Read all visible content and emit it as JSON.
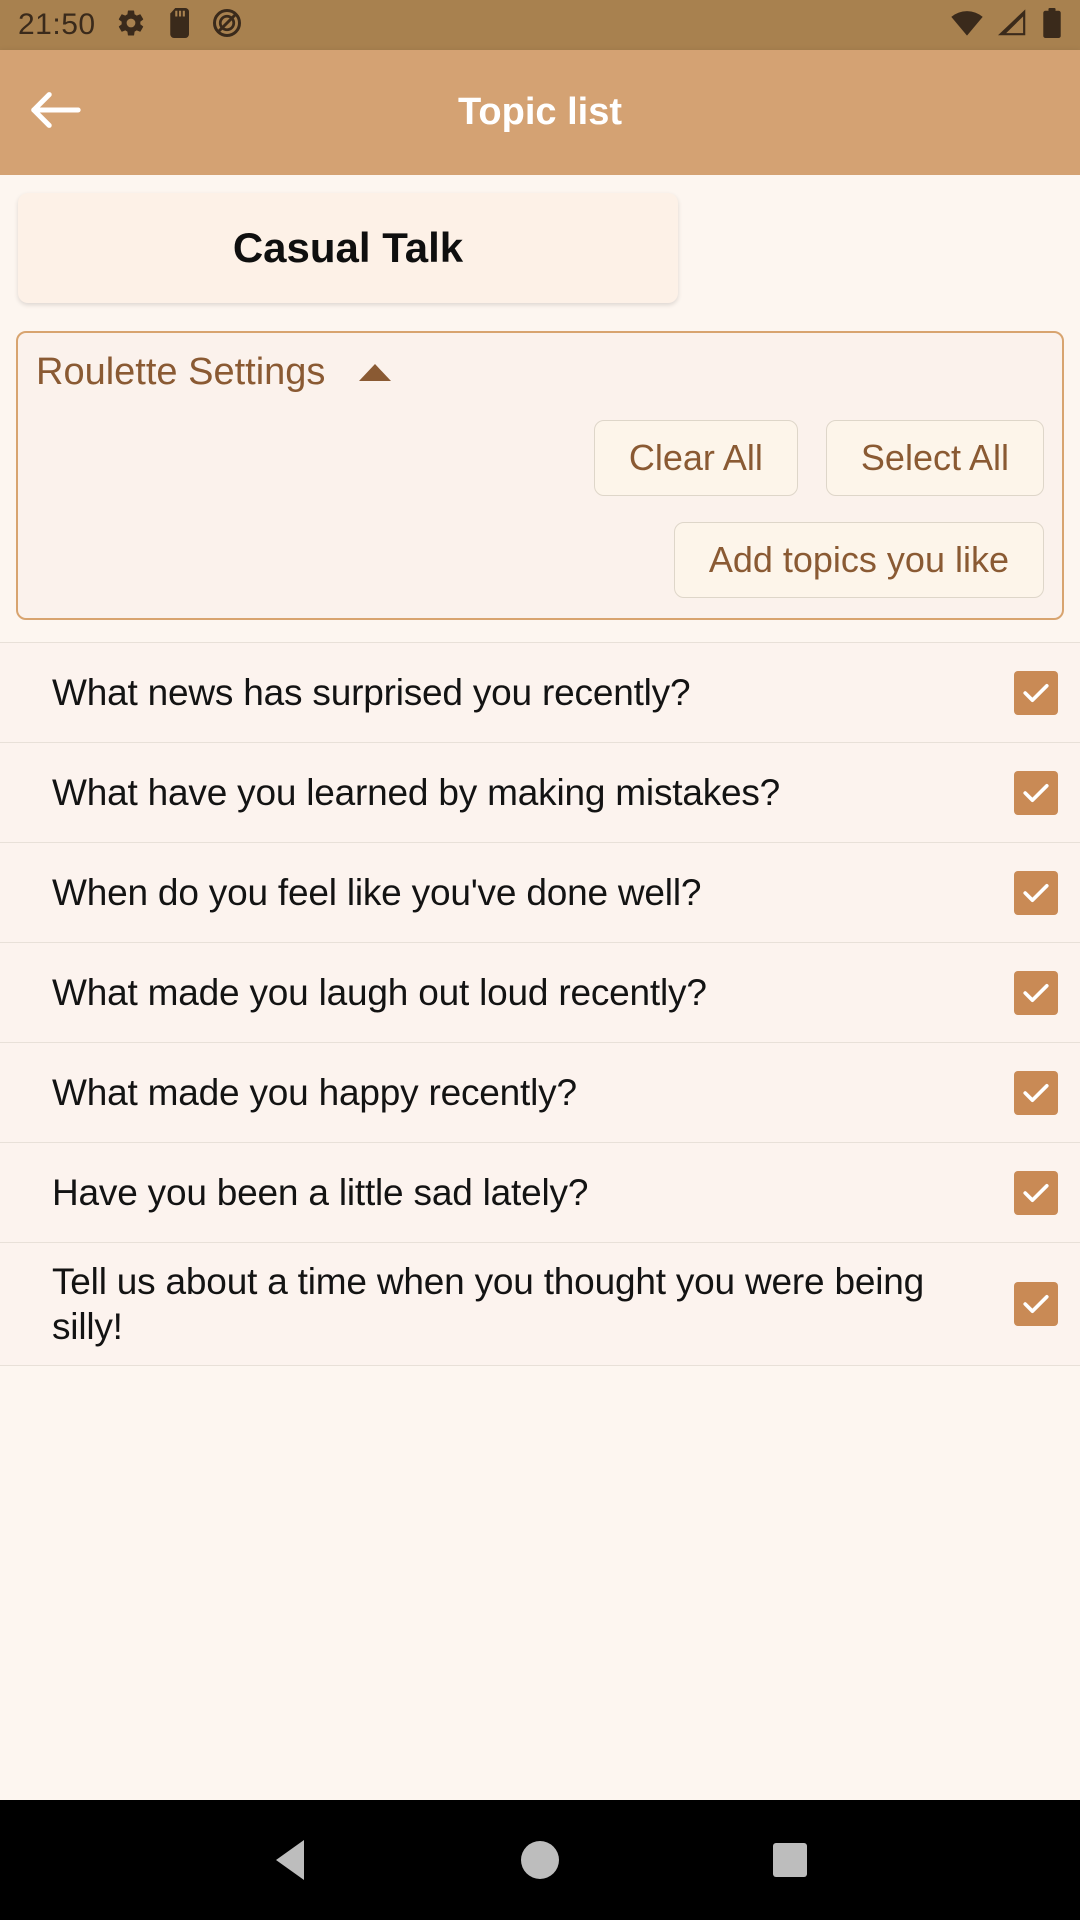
{
  "statusbar": {
    "time": "21:50",
    "left_icons": [
      "settings-gear-icon",
      "sd-card-icon",
      "do-not-disturb-icon"
    ],
    "right_icons": [
      "wifi-icon",
      "cellular-signal-icon",
      "battery-full-icon"
    ],
    "background_color": "#A8814F"
  },
  "appbar": {
    "title": "Topic list",
    "back_icon": "arrow-back-icon",
    "background_color": "#D4A273",
    "title_color": "#FFFFFF"
  },
  "title_card": {
    "label": "Casual Talk"
  },
  "settings_panel": {
    "title": "Roulette Settings",
    "collapse_icon": "caret-up-icon",
    "accent_color": "#8A5A33",
    "border_color": "#D8A46F",
    "buttons": [
      {
        "label": "Clear All",
        "name": "clear-all-button"
      },
      {
        "label": "Select All",
        "name": "select-all-button"
      },
      {
        "label": "Add topics you like",
        "name": "add-topics-button"
      }
    ]
  },
  "topic_list": {
    "checkbox_color": "#C98A55",
    "items": [
      {
        "text": "What news has surprised you recently?",
        "checked": true
      },
      {
        "text": "What have you learned by making mistakes?",
        "checked": true
      },
      {
        "text": "When do you feel like you've done well?",
        "checked": true
      },
      {
        "text": "What made you laugh out loud recently?",
        "checked": true
      },
      {
        "text": "What made you happy recently?",
        "checked": true
      },
      {
        "text": "Have you been a little sad lately?",
        "checked": true
      },
      {
        "text": "Tell us about a time when you thought you were being silly!",
        "checked": true
      }
    ]
  },
  "navbar": {
    "back_icon": "nav-back-triangle-icon",
    "home_icon": "nav-home-circle-icon",
    "recents_icon": "nav-recents-square-icon"
  }
}
